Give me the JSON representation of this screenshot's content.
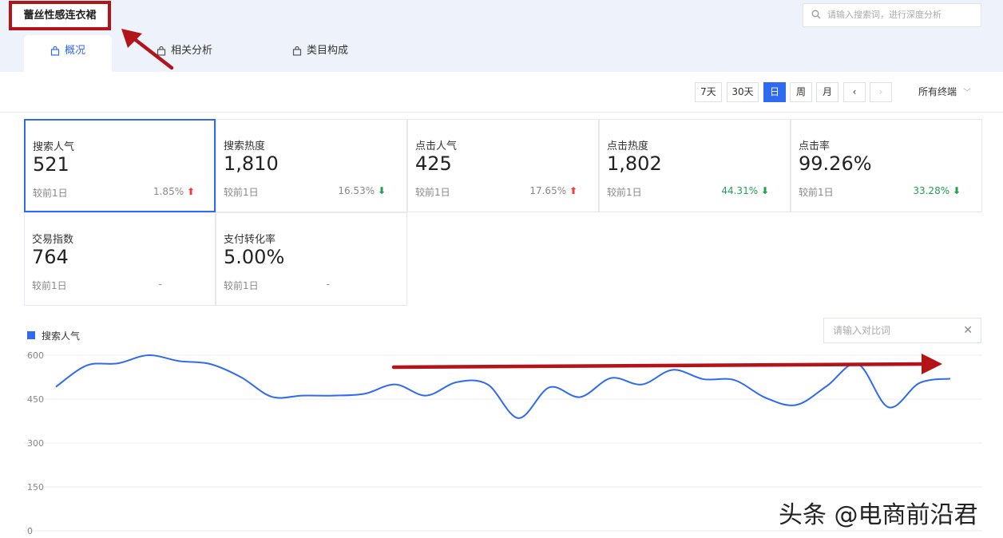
{
  "page": {
    "title": "蕾丝性感连衣裙",
    "search_placeholder": "请输入搜索词，进行深度分析"
  },
  "tabs": [
    {
      "label": "概况",
      "active": true
    },
    {
      "label": "相关分析",
      "active": false
    },
    {
      "label": "类目构成",
      "active": false
    }
  ],
  "toolbar": {
    "ranges": [
      "7天",
      "30天",
      "日",
      "周",
      "月"
    ],
    "active_range": "日",
    "terminal": "所有终端"
  },
  "metrics": [
    {
      "label": "搜索人气",
      "value": "521",
      "compare": "较前1日",
      "pct": "1.85%",
      "trend": "up",
      "selected": true
    },
    {
      "label": "搜索热度",
      "value": "1,810",
      "compare": "较前1日",
      "pct": "16.53%",
      "trend": "down",
      "selected": false
    },
    {
      "label": "点击人气",
      "value": "425",
      "compare": "较前1日",
      "pct": "17.65%",
      "trend": "up",
      "selected": false
    },
    {
      "label": "点击热度",
      "value": "1,802",
      "compare": "较前1日",
      "pct": "44.31%",
      "trend": "down",
      "selected": false
    },
    {
      "label": "点击率",
      "value": "99.26%",
      "compare": "较前1日",
      "pct": "33.28%",
      "trend": "down",
      "selected": false
    },
    {
      "label": "交易指数",
      "value": "764",
      "compare": "较前1日",
      "pct": "-",
      "trend": "none",
      "selected": false
    },
    {
      "label": "支付转化率",
      "value": "5.00%",
      "compare": "较前1日",
      "pct": "-",
      "trend": "none",
      "selected": false
    }
  ],
  "compare_placeholder": "请输入对比词",
  "colors": {
    "accent": "#2f6bf0",
    "up": "#f03d3d",
    "down": "#1fa14e",
    "annotation": "#b3141a"
  },
  "chart_data": {
    "type": "line",
    "series": [
      {
        "name": "搜索人气",
        "values": [
          492,
          565,
          572,
          600,
          580,
          570,
          525,
          458,
          462,
          462,
          468,
          500,
          462,
          508,
          500,
          385,
          490,
          457,
          522,
          500,
          550,
          518,
          515,
          455,
          430,
          495,
          570,
          422,
          505,
          520
        ]
      }
    ],
    "yticks": [
      0,
      150,
      300,
      450,
      600
    ],
    "ylim": [
      0,
      640
    ]
  },
  "watermark": "头条 @电商前沿君"
}
